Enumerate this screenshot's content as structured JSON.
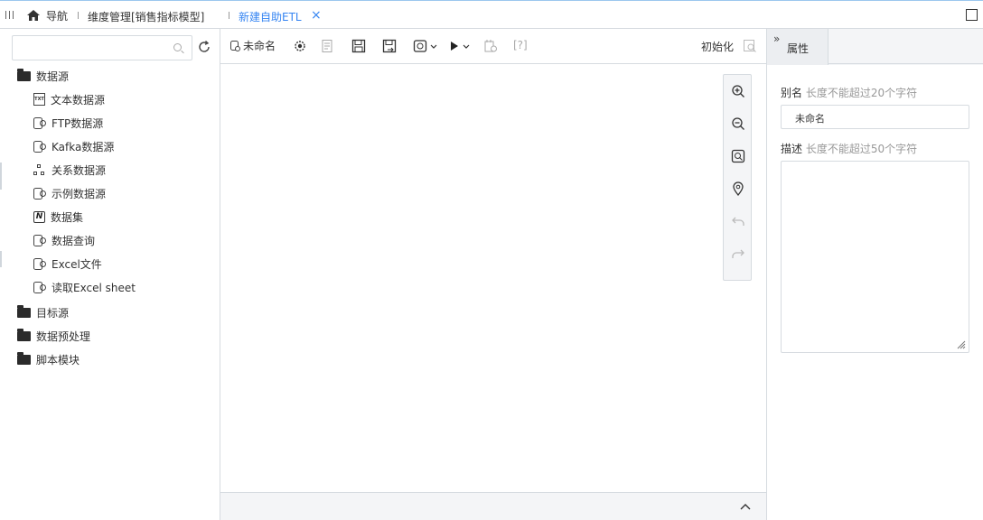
{
  "header": {
    "nav_label": "导航",
    "tabs": [
      {
        "label": "维度管理[销售指标模型]",
        "active": false
      },
      {
        "label": "新建自助ETL",
        "active": true,
        "close": "×"
      }
    ]
  },
  "left_panel": {
    "search": {
      "value": "",
      "placeholder": ""
    },
    "tree": [
      {
        "label": "数据源",
        "icon": "folder-open-icon",
        "expanded": true,
        "children": [
          {
            "label": "文本数据源",
            "icon": "text-file-icon"
          },
          {
            "label": "FTP数据源",
            "icon": "database-icon"
          },
          {
            "label": "Kafka数据源",
            "icon": "database-icon"
          },
          {
            "label": "关系数据源",
            "icon": "relation-icon"
          },
          {
            "label": "示例数据源",
            "icon": "database-icon"
          },
          {
            "label": "数据集",
            "icon": "dataset-icon"
          },
          {
            "label": "数据查询",
            "icon": "database-icon"
          },
          {
            "label": "Excel文件",
            "icon": "database-icon"
          },
          {
            "label": "读取Excel sheet",
            "icon": "database-icon"
          }
        ]
      },
      {
        "label": "目标源",
        "icon": "folder-icon"
      },
      {
        "label": "数据预处理",
        "icon": "folder-icon"
      },
      {
        "label": "脚本模块",
        "icon": "folder-icon"
      }
    ]
  },
  "toolbar": {
    "title": "未命名",
    "init_label": "初始化",
    "help_label": "[?]"
  },
  "right_panel": {
    "tab_label": "属性",
    "collapse_glyph": "»",
    "alias": {
      "label": "别名",
      "hint": "长度不能超过20个字符",
      "value": "未命名"
    },
    "description": {
      "label": "描述",
      "hint": "长度不能超过50个字符",
      "value": ""
    }
  },
  "colors": {
    "accent": "#3685f2",
    "border": "#d6dbe0",
    "panel_bg": "#f4f5f7"
  }
}
